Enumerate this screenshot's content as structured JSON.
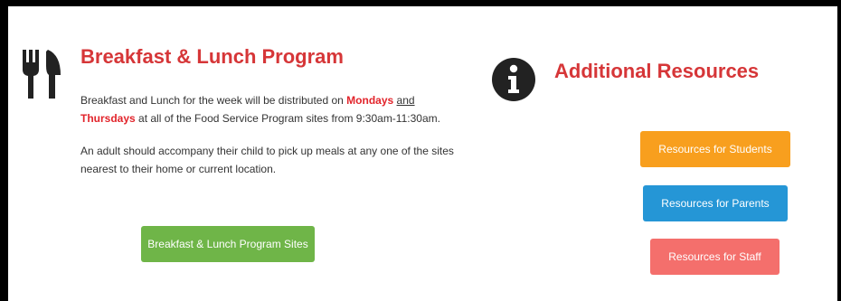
{
  "program": {
    "title": "Breakfast & Lunch Program",
    "para1": {
      "text1": "Breakfast and Lunch for the week will be distributed on ",
      "day1": "Mondays",
      "and": "and",
      "day2": "Thursdays",
      "text2": " at all of the Food Service Program sites from 9:30am-11:30am."
    },
    "para2": "An adult should accompany their child to pick up meals at any one of the sites nearest to their home or current location.",
    "sites_button": "Breakfast & Lunch Program Sites"
  },
  "resources": {
    "title": "Additional Resources",
    "students_button": "Resources for Students",
    "parents_button": "Resources for Parents",
    "staff_button": "Resources for Staff"
  },
  "icons": {
    "left": "fork-knife-icon",
    "right": "info-icon"
  },
  "colors": {
    "heading": "#d63638",
    "highlight": "#e2242b",
    "green": "#6fb548",
    "orange": "#f89f1e",
    "blue": "#2596d6",
    "pink": "#f46f6c"
  }
}
